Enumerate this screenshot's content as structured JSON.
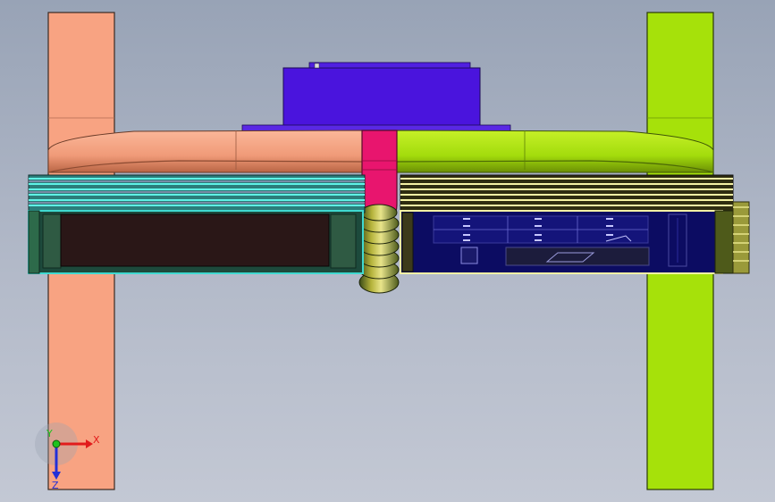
{
  "viewport": {
    "background_top": "#98a3b6",
    "background_bottom": "#c3c8d4"
  },
  "model": {
    "parts": [
      {
        "name": "left-column",
        "color": "#f8a382"
      },
      {
        "name": "right-column",
        "color": "#a6e10a"
      },
      {
        "name": "top-block",
        "color": "#4a14dd"
      },
      {
        "name": "center-clip",
        "color": "#e8156e"
      },
      {
        "name": "left-rails",
        "color": "#3fd9d0"
      },
      {
        "name": "right-rails",
        "color": "#f4f1a4"
      },
      {
        "name": "left-panel-dark",
        "color": "#2a1717"
      },
      {
        "name": "right-panel-dark",
        "color": "#0c0c62"
      },
      {
        "name": "spring-coil",
        "color": "#7d7a18"
      }
    ]
  },
  "triad": {
    "x_label": "X",
    "y_label": "Y",
    "z_label": "Z",
    "x_color": "#e21b1b",
    "y_color": "#1ec21e",
    "z_color": "#2330d8"
  }
}
